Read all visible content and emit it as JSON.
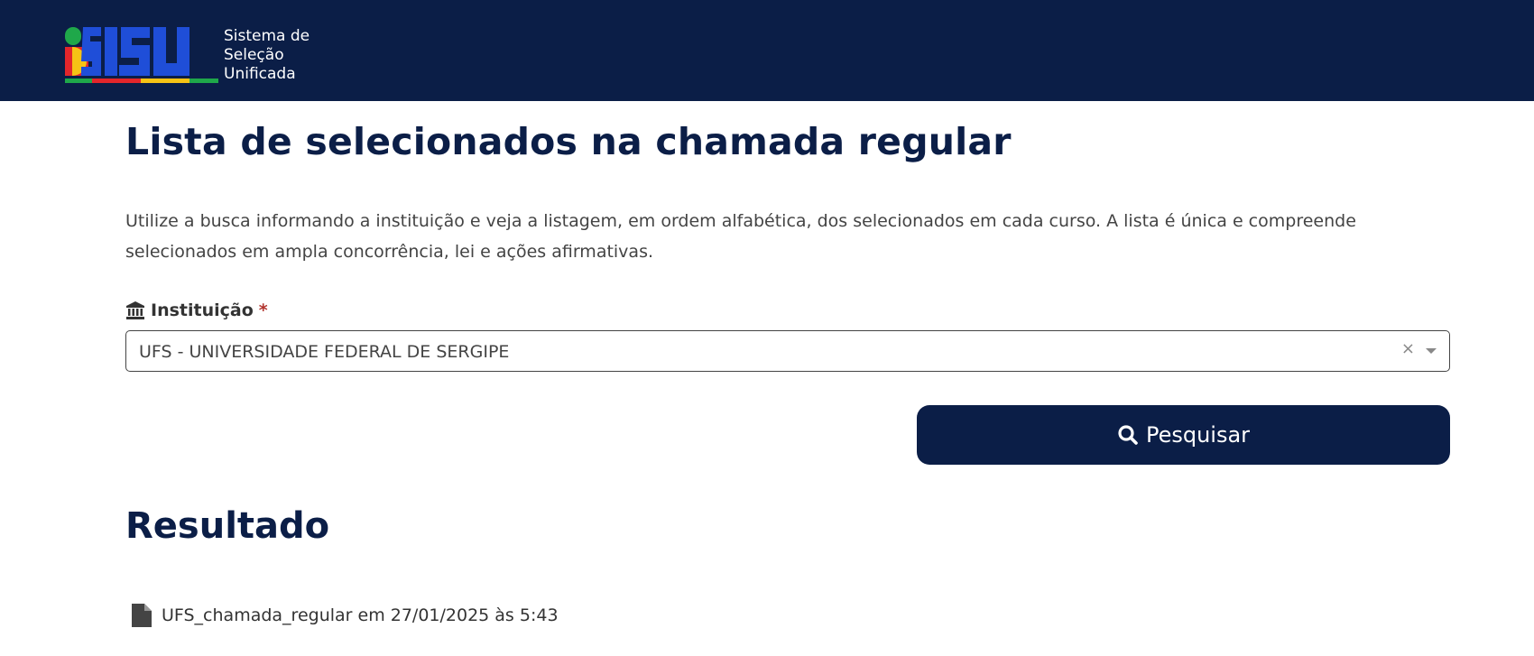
{
  "header": {
    "logo_text": "SISU",
    "tagline_lines": [
      "Sistema de",
      "Seleção",
      "Unificada"
    ]
  },
  "page": {
    "title": "Lista de selecionados na chamada regular",
    "description": "Utilize a busca informando a instituição e veja a listagem, em ordem alfabética, dos selecionados em cada curso. A lista é única e compreende selecionados em ampla concorrência, lei e ações afirmativas."
  },
  "form": {
    "institution_label": "Instituição",
    "required_mark": "*",
    "institution_value": "UFS - UNIVERSIDADE FEDERAL DE SERGIPE",
    "clear_glyph": "×",
    "search_label": "Pesquisar",
    "icons": {
      "label": "institution-icon",
      "clear": "close-icon",
      "dropdown": "caret-down-icon",
      "search": "search-icon"
    }
  },
  "results": {
    "heading": "Resultado",
    "files": [
      {
        "label": "UFS_chamada_regular em 27/01/2025 às 5:43",
        "icon": "file-icon"
      }
    ]
  },
  "colors": {
    "navy": "#0b1e47",
    "required": "#b2342e",
    "logo_green": "#1fa84a",
    "logo_red": "#e3262b",
    "logo_yellow": "#f6c315",
    "logo_blue": "#1f4ed8"
  }
}
